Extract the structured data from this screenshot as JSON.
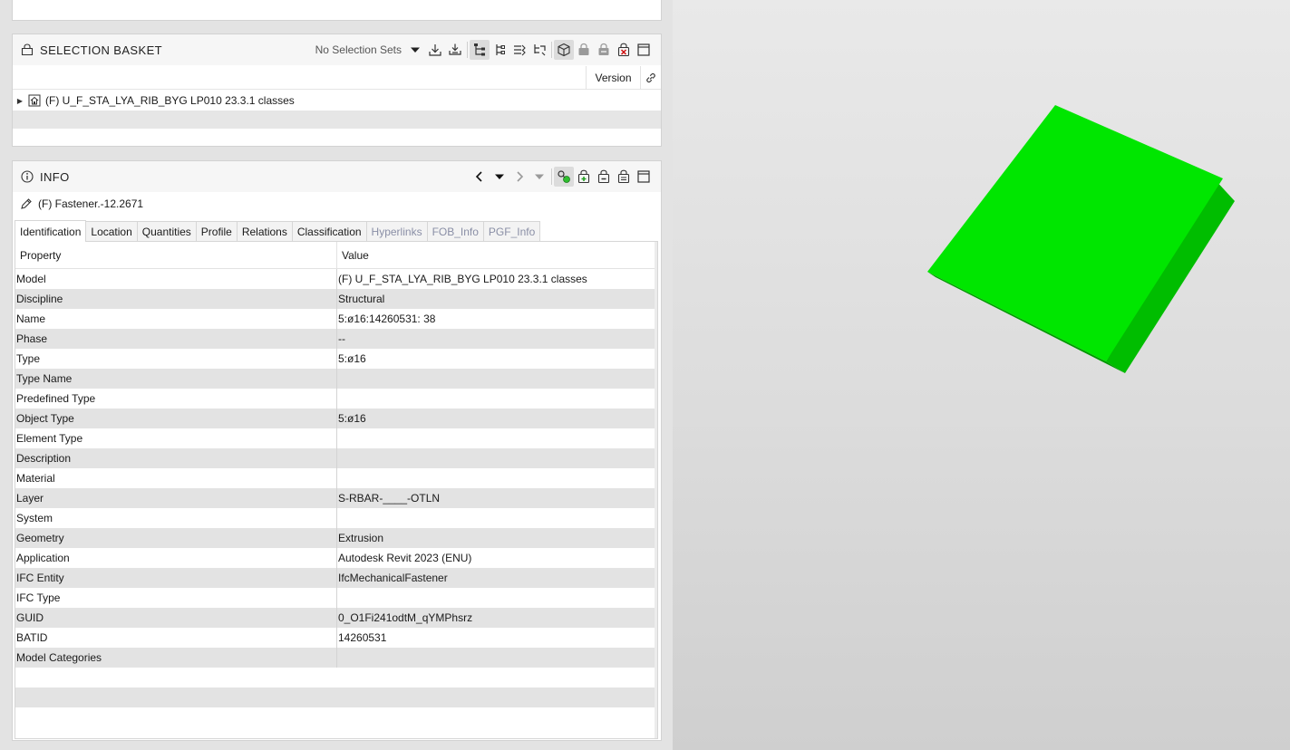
{
  "basket": {
    "title": "SELECTION BASKET",
    "selection_sets_label": "No Selection Sets",
    "version_column": "Version",
    "item_label": "(F) U_F_STA_LYA_RIB_BYG LP010 23.3.1 classes"
  },
  "info": {
    "title": "INFO",
    "subject": "(F) Fastener.-12.2671",
    "tabs": [
      {
        "label": "Identification",
        "state": "active"
      },
      {
        "label": "Location",
        "state": "normal"
      },
      {
        "label": "Quantities",
        "state": "normal"
      },
      {
        "label": "Profile",
        "state": "normal"
      },
      {
        "label": "Relations",
        "state": "normal"
      },
      {
        "label": "Classification",
        "state": "normal"
      },
      {
        "label": "Hyperlinks",
        "state": "disabled"
      },
      {
        "label": "FOB_Info",
        "state": "disabled"
      },
      {
        "label": "PGF_Info",
        "state": "disabled"
      }
    ],
    "columns": {
      "property": "Property",
      "value": "Value"
    },
    "rows": [
      {
        "property": "Model",
        "value": "(F) U_F_STA_LYA_RIB_BYG LP010 23.3.1 classes"
      },
      {
        "property": "Discipline",
        "value": "Structural"
      },
      {
        "property": "Name",
        "value": "5:ø16:14260531: 38"
      },
      {
        "property": "Phase",
        "value": "--"
      },
      {
        "property": "Type",
        "value": "5:ø16"
      },
      {
        "property": "Type Name",
        "value": ""
      },
      {
        "property": "Predefined Type",
        "value": ""
      },
      {
        "property": "Object Type",
        "value": "5:ø16"
      },
      {
        "property": "Element Type",
        "value": ""
      },
      {
        "property": "Description",
        "value": ""
      },
      {
        "property": "Material",
        "value": ""
      },
      {
        "property": "Layer",
        "value": "S-RBAR-____-OTLN"
      },
      {
        "property": "System",
        "value": ""
      },
      {
        "property": "Geometry",
        "value": "Extrusion"
      },
      {
        "property": "Application",
        "value": "Autodesk Revit 2023 (ENU)"
      },
      {
        "property": "IFC Entity",
        "value": "IfcMechanicalFastener"
      },
      {
        "property": "IFC Type",
        "value": ""
      },
      {
        "property": "GUID",
        "value": "0_O1Fi241odtM_qYMPhsrz"
      },
      {
        "property": "BATID",
        "value": "14260531"
      },
      {
        "property": "Model Categories",
        "value": ""
      }
    ]
  },
  "viewport": {
    "object_colors": {
      "top": "#00e600",
      "side": "#00bd00",
      "edge": "#009a00"
    }
  },
  "icons": {
    "basket": "basket-icon",
    "info": "info-icon",
    "link": "link-icon",
    "pencil": "pencil-icon"
  }
}
